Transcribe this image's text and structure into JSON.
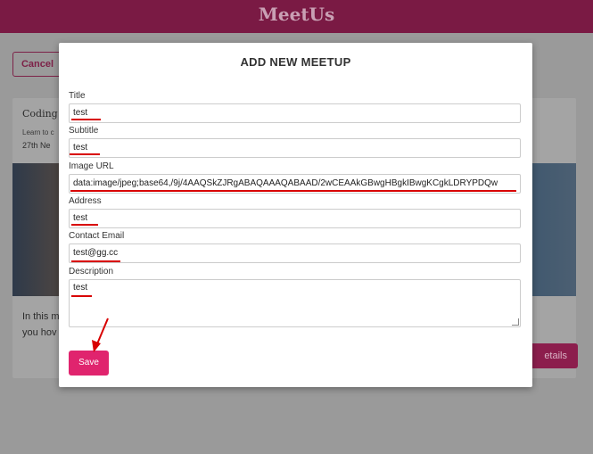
{
  "app": {
    "title": "MeetUs"
  },
  "background": {
    "cancel_label": "Cancel",
    "card": {
      "title": "Coding I",
      "subtitle": "Learn to c",
      "date": "27th Ne",
      "description": "In this m you hov",
      "details_label": "etails"
    }
  },
  "modal": {
    "title": "ADD NEW MEETUP",
    "fields": {
      "title": {
        "label": "Title",
        "value": "test"
      },
      "subtitle": {
        "label": "Subtitle",
        "value": "test"
      },
      "image_url": {
        "label": "Image URL",
        "value": "data:image/jpeg;base64,/9j/4AAQSkZJRgABAQAAAQABAAD/2wCEAAkGBwgHBgkIBwgKCgkLDRYPDQw"
      },
      "address": {
        "label": "Address",
        "value": "test"
      },
      "contact_email": {
        "label": "Contact Email",
        "value": "test@gg.cc"
      },
      "description": {
        "label": "Description",
        "value": "test"
      }
    },
    "save_label": "Save"
  },
  "colors": {
    "brand": "#e0246e",
    "topbar": "#7a1a44",
    "annotation": "#d80000"
  }
}
